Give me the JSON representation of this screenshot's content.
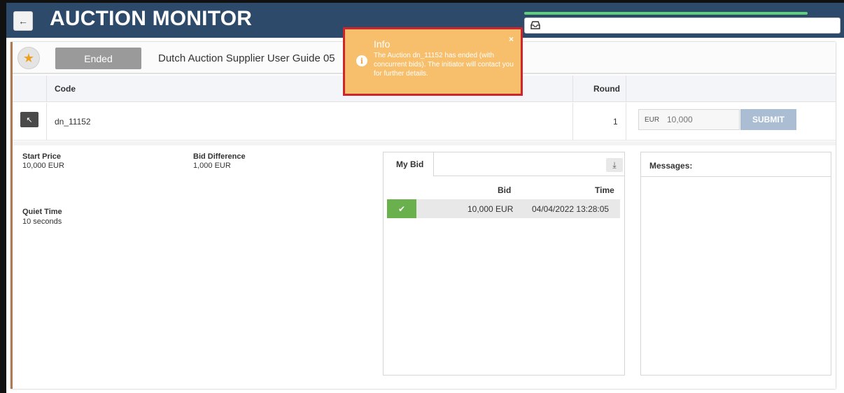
{
  "header": {
    "title": "AUCTION MONITOR",
    "back_icon": "arrow-left-icon",
    "inbox_icon": "inbox-icon"
  },
  "auction": {
    "status": "Ended",
    "name": "Dutch Auction Supplier User Guide 05"
  },
  "table": {
    "columns": {
      "code": "Code",
      "round": "Round"
    },
    "row": {
      "code": "dn_11152",
      "round": "1"
    }
  },
  "bid_form": {
    "currency": "EUR",
    "placeholder": "10,000",
    "submit_label": "SUBMIT"
  },
  "details": {
    "start_price_label": "Start Price",
    "start_price_value": "10,000 EUR",
    "bid_difference_label": "Bid Difference",
    "bid_difference_value": "1,000 EUR",
    "quiet_time_label": "Quiet Time",
    "quiet_time_value": "10 seconds"
  },
  "my_bid": {
    "tab_label": "My Bid",
    "col_bid": "Bid",
    "col_time": "Time",
    "rows": [
      {
        "bid": "10,000 EUR",
        "time": "04/04/2022 13:28:05"
      }
    ]
  },
  "messages": {
    "title": "Messages:"
  },
  "toast": {
    "title": "Info",
    "message": "The Auction dn_11152 has ended (with concurrent bids). The initiator will contact you for further details.",
    "close": "×",
    "icon": "i"
  },
  "colors": {
    "header_bg": "#2e4a6b",
    "toast_bg": "#f7bf6b",
    "toast_border": "#d0242b",
    "success": "#6ab04c",
    "submit_bg": "#aabdd3",
    "progress": "#5fd07a"
  }
}
